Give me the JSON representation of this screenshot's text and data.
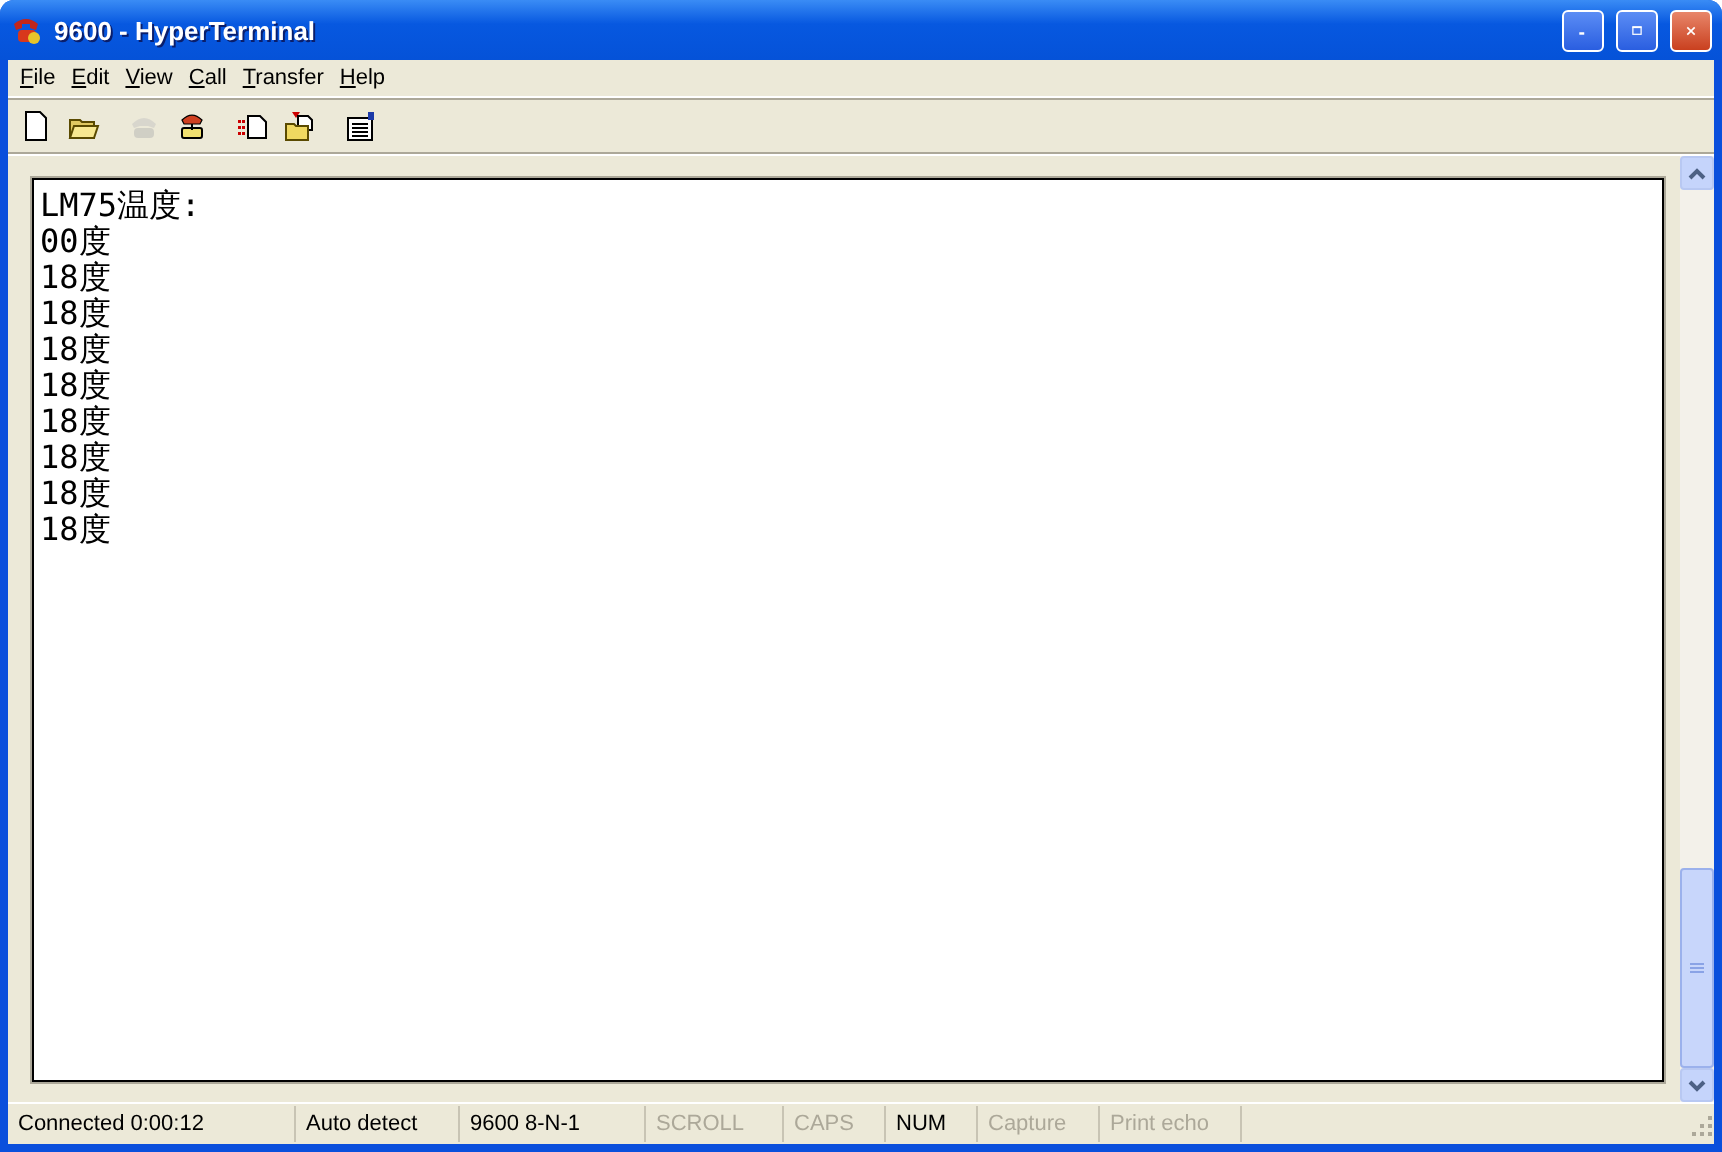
{
  "window": {
    "title": "9600 - HyperTerminal"
  },
  "menu": [
    "File",
    "Edit",
    "View",
    "Call",
    "Transfer",
    "Help"
  ],
  "toolbar": [
    {
      "kind": "new",
      "disabled": false
    },
    {
      "kind": "open",
      "disabled": false
    },
    {
      "kind": "phone",
      "disabled": true
    },
    {
      "kind": "dial",
      "disabled": false
    },
    {
      "kind": "send",
      "disabled": false
    },
    {
      "kind": "receive",
      "disabled": false
    },
    {
      "kind": "properties",
      "disabled": false
    }
  ],
  "terminal": {
    "lines": [
      "LM75温度:",
      "00度",
      "18度",
      "18度",
      "18度",
      "18度",
      "18度",
      "18度",
      "18度",
      "18度"
    ]
  },
  "status_bar": [
    {
      "text": "Connected 0:00:12",
      "enabled": true
    },
    {
      "text": "Auto detect",
      "enabled": true
    },
    {
      "text": "9600 8-N-1",
      "enabled": true
    },
    {
      "text": "SCROLL",
      "enabled": false
    },
    {
      "text": "CAPS",
      "enabled": false
    },
    {
      "text": "NUM",
      "enabled": true
    },
    {
      "text": "Capture",
      "enabled": false
    },
    {
      "text": "Print echo",
      "enabled": false
    }
  ]
}
